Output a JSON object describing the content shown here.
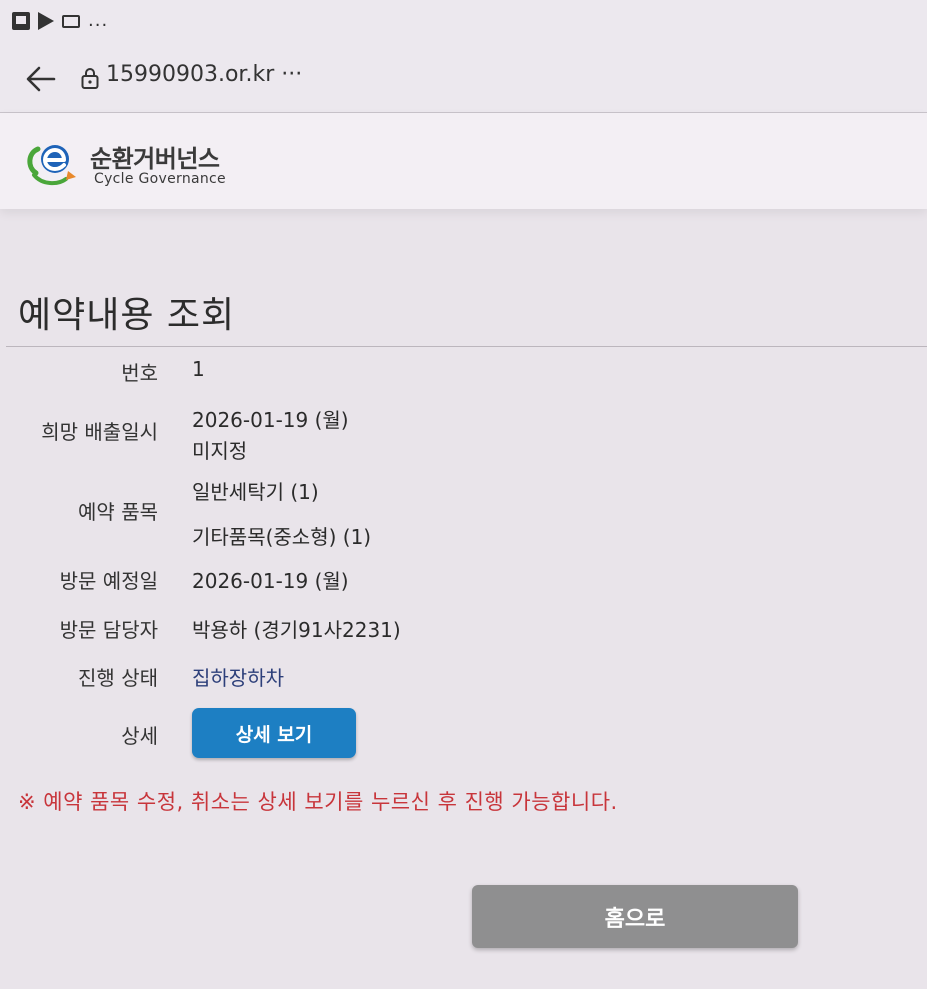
{
  "statusbar": {
    "more": "..."
  },
  "browser": {
    "url": "15990903.or.kr ···"
  },
  "site": {
    "name_ko": "순환거버넌스",
    "name_en": "Cycle Governance",
    "brand_colors": {
      "logo_blue": "#1e63b8",
      "logo_green": "#4aa63a",
      "logo_orange": "#e8882a"
    }
  },
  "page": {
    "title": "예약내용 조회"
  },
  "details": {
    "number": {
      "label": "번호",
      "value": "1"
    },
    "desired_date": {
      "label": "희망 배출일시",
      "value": "2026-01-19 (월)",
      "value2": "미지정"
    },
    "items": {
      "label": "예약 품목",
      "value": "일반세탁기 (1)",
      "value2": "기타품목(중소형) (1)"
    },
    "visit_date": {
      "label": "방문 예정일",
      "value": "2026-01-19 (월)"
    },
    "visitor": {
      "label": "방문 담당자",
      "value": "박용하 (경기91사2231)"
    },
    "status": {
      "label": "진행 상태",
      "value": "집하장하차"
    },
    "detail": {
      "label": "상세",
      "button": "상세 보기"
    }
  },
  "notice": "※ 예약 품목 수정, 취소는 상세 보기를 누르신 후 진행 가능합니다.",
  "home_button": "홈으로",
  "colors": {
    "primary_button": "#1d7fc3",
    "notice_red": "#c8353b",
    "status_blue": "#2d3f7a",
    "home_button_gray": "#8f8f90"
  }
}
